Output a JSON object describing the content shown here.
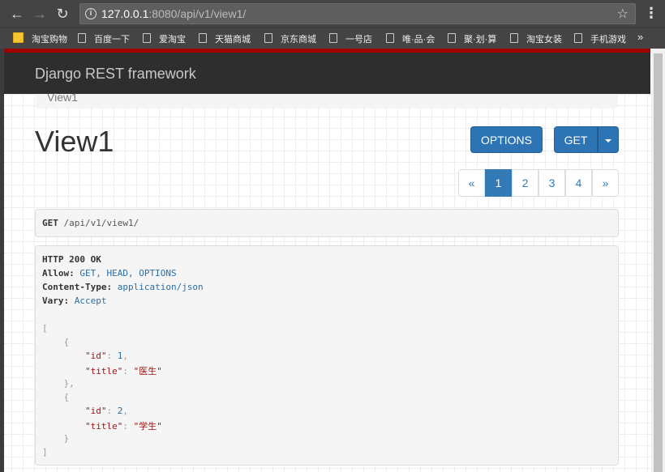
{
  "browser": {
    "url_host": "127.0.0.1",
    "url_rest": ":8080/api/v1/view1/",
    "bookmarks": [
      "淘宝购物",
      "百度一下",
      "爱淘宝",
      "天猫商城",
      "京东商城",
      "一号店",
      "唯·品·会",
      "聚·划·算",
      "淘宝女装",
      "手机游戏"
    ],
    "more": "»"
  },
  "navbar": {
    "brand": "Django REST framework"
  },
  "breadcrumb": {
    "item": "View1"
  },
  "page": {
    "title": "View1",
    "options_label": "OPTIONS",
    "get_label": "GET"
  },
  "pagination": {
    "prev": "«",
    "pages": [
      "1",
      "2",
      "3",
      "4"
    ],
    "active": "1",
    "next": "»"
  },
  "request": {
    "method": "GET",
    "path": "/api/v1/view1/"
  },
  "response": {
    "status": "HTTP 200 OK",
    "headers": [
      {
        "key": "Allow:",
        "value": "GET, HEAD, OPTIONS"
      },
      {
        "key": "Content-Type:",
        "value": "application/json"
      },
      {
        "key": "Vary:",
        "value": "Accept"
      }
    ],
    "items": [
      {
        "id": "1",
        "title": "\"医生\""
      },
      {
        "id": "2",
        "title": "\"学生\""
      }
    ]
  },
  "colors": {
    "primary": "#337ab7",
    "navbar": "#2e2e2e",
    "accent_strip": "#a30000"
  }
}
